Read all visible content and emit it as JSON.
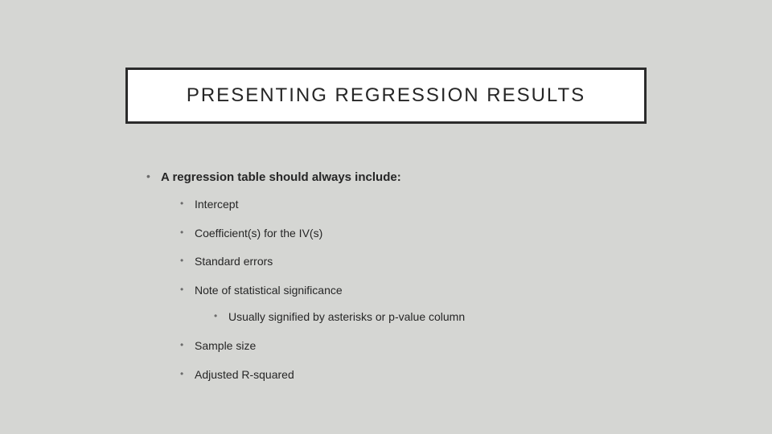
{
  "title": "PRESENTING REGRESSION RESULTS",
  "intro": "A regression table should always include:",
  "items": {
    "i0": "Intercept",
    "i1": "Coefficient(s) for the IV(s)",
    "i2": "Standard errors",
    "i3": "Note of statistical significance",
    "i3sub": "Usually signified by asterisks or p-value column",
    "i4": "Sample size",
    "i5": "Adjusted R-squared"
  }
}
